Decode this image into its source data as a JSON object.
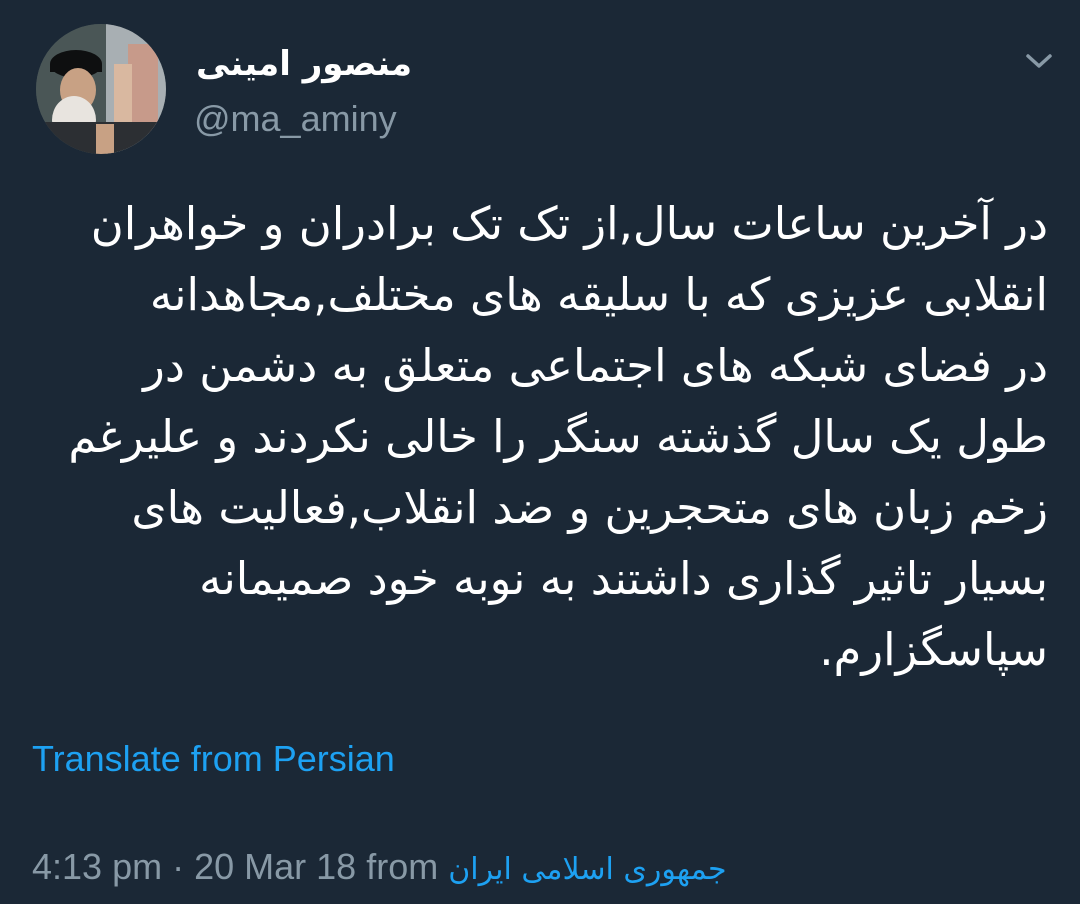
{
  "author": {
    "display_name": "منصور امینی",
    "handle": "@ma_aminy",
    "avatar_icon": "profile-photo"
  },
  "menu": {
    "icon": "chevron-down-icon"
  },
  "tweet": {
    "lines": [
      "در آخرین ساعات سال,از تک تک برادران و خواهران",
      "انقلابی عزیزی که با سلیقه های مختلف,مجاهدانه",
      "در فضای شبکه های اجتماعی متعلق به دشمن در",
      "طول یک سال گذشته سنگر را خالی نکردند و علیرغم",
      "زخم زبان های متحجرین و ضد انقلاب,فعالیت های",
      "بسیار تاثیر گذاری داشتند به نوبه خود صمیمانه",
      "سپاسگزارم."
    ]
  },
  "translate": {
    "label": "Translate from Persian"
  },
  "meta": {
    "time": "4:13 pm",
    "separator": "·",
    "date": "20 Mar 18",
    "from_label": "from",
    "source": "جمهوری اسلامی ایران"
  },
  "colors": {
    "background": "#1b2836",
    "text": "#ffffff",
    "muted": "#8899a6",
    "link": "#1da1f2"
  }
}
